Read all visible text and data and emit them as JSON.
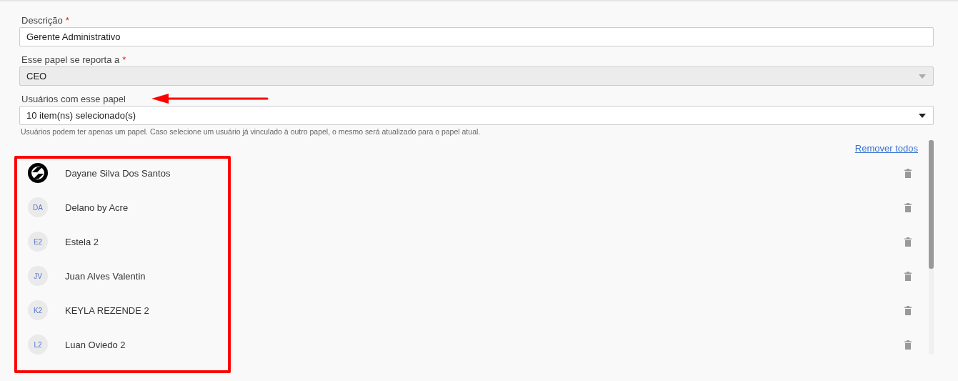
{
  "fields": [
    {
      "kind": "text",
      "label": "Descrição",
      "required_mark": "*",
      "value": "Gerente Administrativo",
      "disabled": false
    },
    {
      "kind": "select",
      "label": "Esse papel se reporta a",
      "required_mark": "*",
      "value": "CEO",
      "disabled": true
    },
    {
      "kind": "select",
      "label": "Usuários com esse papel",
      "value": "10 item(ns) selecionado(s)",
      "disabled": false,
      "hint": "Usuários podem ter apenas um papel. Caso selecione um usuário já vinculado à outro papel, o mesmo será atualizado para o papel atual."
    }
  ],
  "remove_all_link": "Remover todos",
  "users": [
    {
      "kind": "logo",
      "name": "Dayane Silva Dos Santos"
    },
    {
      "kind": "initials",
      "initials": "DA",
      "name": "Delano by Acre"
    },
    {
      "kind": "initials",
      "initials": "E2",
      "name": "Estela 2"
    },
    {
      "kind": "initials",
      "initials": "JV",
      "name": "Juan Alves Valentin"
    },
    {
      "kind": "initials",
      "initials": "K2",
      "name": "KEYLA REZENDE 2"
    },
    {
      "kind": "initials",
      "initials": "L2",
      "name": "Luan Oviedo 2"
    }
  ]
}
